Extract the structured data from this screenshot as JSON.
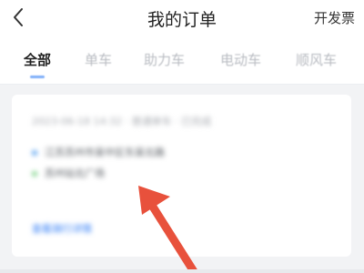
{
  "header": {
    "title": "我的订单",
    "action_label": "开发票",
    "back_icon": "chevron-left-icon"
  },
  "tabs": [
    {
      "label": "全部",
      "active": true
    },
    {
      "label": "单车",
      "active": false
    },
    {
      "label": "助力车",
      "active": false
    },
    {
      "label": "电动车",
      "active": false
    },
    {
      "label": "顺风车",
      "active": false
    }
  ],
  "colors": {
    "accent": "#2f7cf6",
    "start_dot": "#5aa4f0",
    "end_dot": "#7fd48a",
    "annotation_arrow": "#e8513c"
  },
  "order_card": {
    "meta": "2023-06-18 14:32 · 普通单车 · 已完成",
    "start": "江苏苏州市吴中区东吴北路",
    "end": "苏州站北广场",
    "link_label": "查看骑行详情"
  }
}
